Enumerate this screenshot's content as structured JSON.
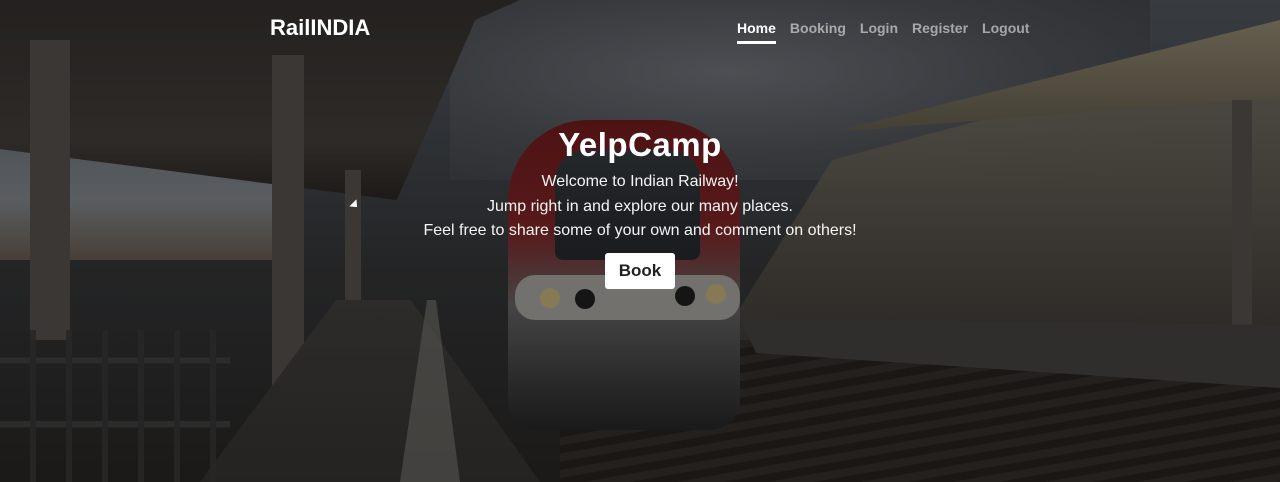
{
  "navbar": {
    "brand": "RailINDIA",
    "links": [
      {
        "label": "Home",
        "active": true
      },
      {
        "label": "Booking",
        "active": false
      },
      {
        "label": "Login",
        "active": false
      },
      {
        "label": "Register",
        "active": false
      },
      {
        "label": "Logout",
        "active": false
      }
    ]
  },
  "hero": {
    "title": "YelpCamp",
    "lines": [
      "Welcome to Indian Railway!",
      "Jump right in and explore our many places.",
      "Feel free to share some of your own and comment on others!"
    ],
    "button_label": "Book"
  },
  "background": {
    "subject": "train-at-station-photo",
    "overlay_color": "#000000"
  }
}
